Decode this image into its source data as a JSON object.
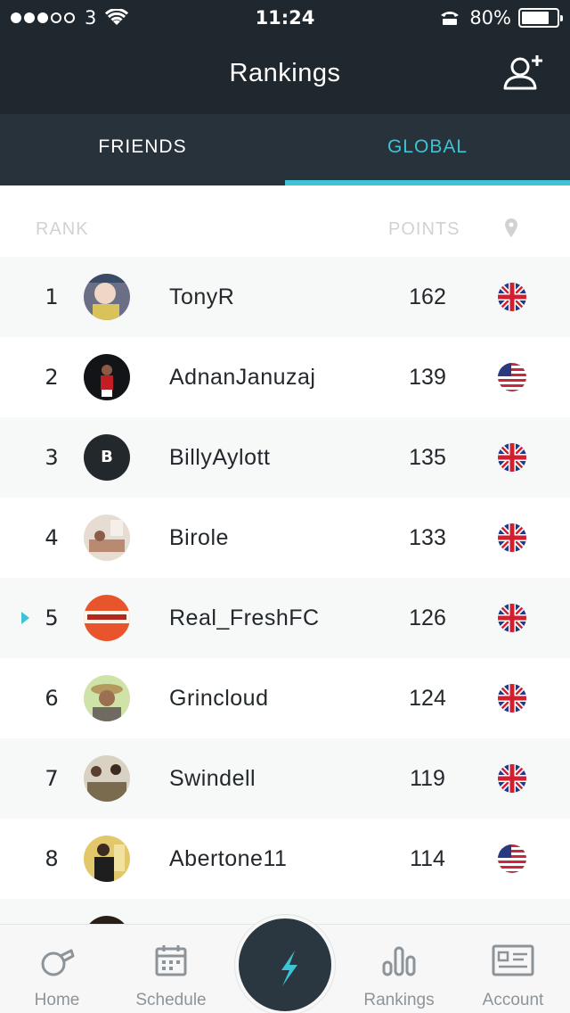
{
  "status": {
    "carrier": "3",
    "time": "11:24",
    "battery": "80%",
    "battery_level": 0.8
  },
  "nav": {
    "title": "Rankings",
    "add_friend_icon": "add-person-icon"
  },
  "tabs": [
    {
      "label": "FRIENDS",
      "active": false
    },
    {
      "label": "GLOBAL",
      "active": true
    }
  ],
  "table": {
    "rank_header": "RANK",
    "points_header": "POINTS",
    "location_icon": "location-pin-icon"
  },
  "rows": [
    {
      "rank": "1",
      "name": "TonyR",
      "points": "162",
      "flag": "uk",
      "avatar": "photo"
    },
    {
      "rank": "2",
      "name": "AdnanJanuzaj",
      "points": "139",
      "flag": "us",
      "avatar": "photo"
    },
    {
      "rank": "3",
      "name": "BillyAylott",
      "points": "135",
      "flag": "uk",
      "avatar": "letter",
      "avatar_letter": "B"
    },
    {
      "rank": "4",
      "name": "Birole",
      "points": "133",
      "flag": "uk",
      "avatar": "photo"
    },
    {
      "rank": "5",
      "name": "Real_FreshFC",
      "points": "126",
      "flag": "uk",
      "avatar": "logo",
      "current_user": true
    },
    {
      "rank": "6",
      "name": "Grincloud",
      "points": "124",
      "flag": "uk",
      "avatar": "photo"
    },
    {
      "rank": "7",
      "name": "Swindell",
      "points": "119",
      "flag": "uk",
      "avatar": "photo"
    },
    {
      "rank": "8",
      "name": "Abertone11",
      "points": "114",
      "flag": "us",
      "avatar": "photo"
    }
  ],
  "tabbar": [
    {
      "label": "Home",
      "icon": "whistle-icon"
    },
    {
      "label": "Schedule",
      "icon": "calendar-icon"
    },
    {
      "label": "",
      "icon": "lightning-icon"
    },
    {
      "label": "Rankings",
      "icon": "bar-chart-icon"
    },
    {
      "label": "Account",
      "icon": "id-card-icon"
    }
  ],
  "colors": {
    "dark": "#1f282e",
    "tab_bg": "#27323a",
    "accent": "#3cc4d4",
    "text": "#22282c"
  }
}
